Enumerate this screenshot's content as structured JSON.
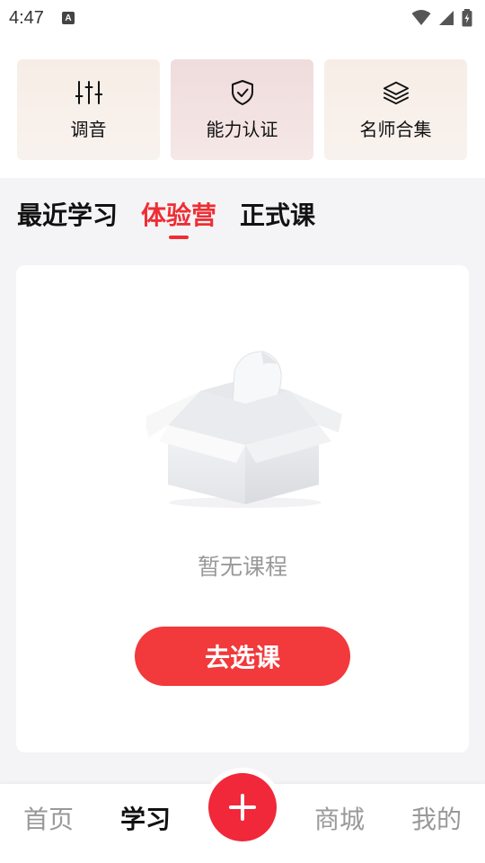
{
  "status_bar": {
    "time": "4:47",
    "badge": "A"
  },
  "features": [
    {
      "label": "调音",
      "icon": "sliders-icon"
    },
    {
      "label": "能力认证",
      "icon": "shield-check-icon"
    },
    {
      "label": "名师合集",
      "icon": "layers-icon"
    }
  ],
  "tabs": [
    {
      "label": "最近学习",
      "active": false
    },
    {
      "label": "体验营",
      "active": true
    },
    {
      "label": "正式课",
      "active": false
    }
  ],
  "empty_state": {
    "illustration": "empty-box-icon",
    "message": "暂无课程",
    "button_label": "去选课"
  },
  "bottom_nav": {
    "items": [
      {
        "label": "首页",
        "active": false
      },
      {
        "label": "学习",
        "active": true
      },
      {
        "label": "商城",
        "active": false
      },
      {
        "label": "我的",
        "active": false
      }
    ],
    "fab_icon": "plus-icon"
  },
  "colors": {
    "accent": "#ee2e34",
    "button": "#f2393b",
    "fab": "#f0283a",
    "muted_text": "#999999",
    "background": "#f4f4f6"
  }
}
